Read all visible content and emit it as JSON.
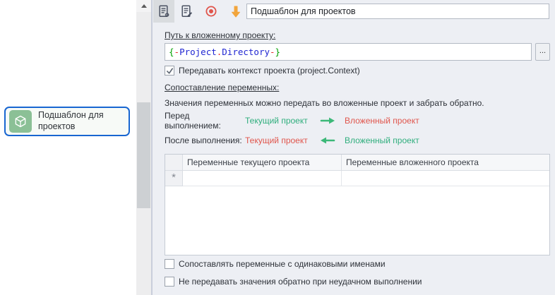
{
  "colors": {
    "accent_blue": "#1866d1",
    "card_bg": "#f7faf7",
    "cube_green": "#8bc096",
    "panel_bg": "#edeff4",
    "icon_slate": "#4b5262",
    "record_red": "#e0544b",
    "arrow_orange": "#f2a53c",
    "green_text": "#2fae7d",
    "red_text": "#e0554c",
    "arrow_green": "#3cb878",
    "syn_green": "#00a000",
    "syn_red": "#e52e2e",
    "syn_blue": "#2026d2"
  },
  "icons": {
    "cube-icon": "wireframe 3d cube on green tile",
    "document-settings-icon": "document with gear badge",
    "document-edit-icon": "document with pen badge",
    "record-icon": "red ring with red dot",
    "down-arrow-icon": "solid orange arrow pointing down",
    "arrow-right-icon": "green arrow pointing right",
    "arrow-left-icon": "green arrow pointing left",
    "scrollbar-up-icon": "small triangle pointing up"
  },
  "left_panel": {
    "card": {
      "label": "Подшаблон для проектов"
    }
  },
  "toolbar": {
    "title_value": "Подшаблон для проектов"
  },
  "form": {
    "path_label": "Путь к вложенному проекту:",
    "path_parts": [
      {
        "text": "{",
        "color": "green"
      },
      {
        "text": "-",
        "color": "red"
      },
      {
        "text": "Project",
        "color": "blue"
      },
      {
        "text": ".",
        "color": "red"
      },
      {
        "text": "Directory",
        "color": "blue"
      },
      {
        "text": "-",
        "color": "red"
      },
      {
        "text": "}",
        "color": "green"
      }
    ],
    "browse_label": "...",
    "context_checkbox_label": "Передавать контекст проекта (project.Context)",
    "context_checkbox_checked": true,
    "mapping_label": "Сопоставление переменных:",
    "mapping_description": "Значения переменных можно передать во вложенные проект и забрать обратно.",
    "before_row": {
      "label": "Перед выполнением:",
      "source": "Текущий проект",
      "target": "Вложенный проект"
    },
    "after_row": {
      "label": "После выполнения:",
      "source": "Текущий проект",
      "target": "Вложенный проект"
    },
    "table": {
      "col1": "Переменные текущего проекта",
      "col2": "Переменные вложенного проекта",
      "new_row_marker": "*"
    },
    "match_names_checkbox_label": "Сопоставлять переменные с одинаковыми именами",
    "match_names_checkbox_checked": false,
    "no_return_checkbox_label": "Не передавать значения обратно при неудачном выполнении",
    "no_return_checkbox_checked": false
  }
}
